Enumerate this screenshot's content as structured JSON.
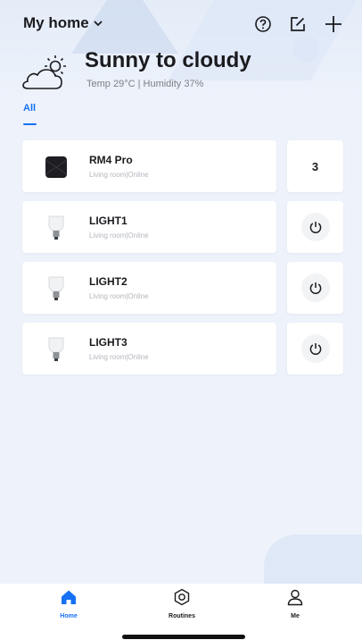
{
  "header": {
    "home_label": "My home",
    "icons": [
      "help-icon",
      "edit-icon",
      "add-icon"
    ]
  },
  "weather": {
    "title": "Sunny to cloudy",
    "subtitle": "Temp 29°C | Humidity 37%",
    "icon": "partly-cloudy-icon"
  },
  "tabs": [
    {
      "label": "All",
      "active": true
    }
  ],
  "devices": [
    {
      "name": "RM4 Pro",
      "meta": "Living room|Online",
      "icon": "remote-hub-icon",
      "side": "count",
      "count": "3"
    },
    {
      "name": "LIGHT1",
      "meta": "Living room|Online",
      "icon": "bulb-icon",
      "side": "power"
    },
    {
      "name": "LIGHT2",
      "meta": "Living room|Online",
      "icon": "bulb-icon",
      "side": "power"
    },
    {
      "name": "LIGHT3",
      "meta": "Living room|Online",
      "icon": "bulb-icon",
      "side": "power"
    }
  ],
  "bottom_nav": [
    {
      "label": "Home",
      "icon": "home-icon",
      "active": true
    },
    {
      "label": "Routines",
      "icon": "routines-icon",
      "active": false
    },
    {
      "label": "Me",
      "icon": "profile-icon",
      "active": false
    }
  ],
  "colors": {
    "accent": "#1671f5",
    "background": "#eef3fb",
    "card": "#ffffff"
  }
}
